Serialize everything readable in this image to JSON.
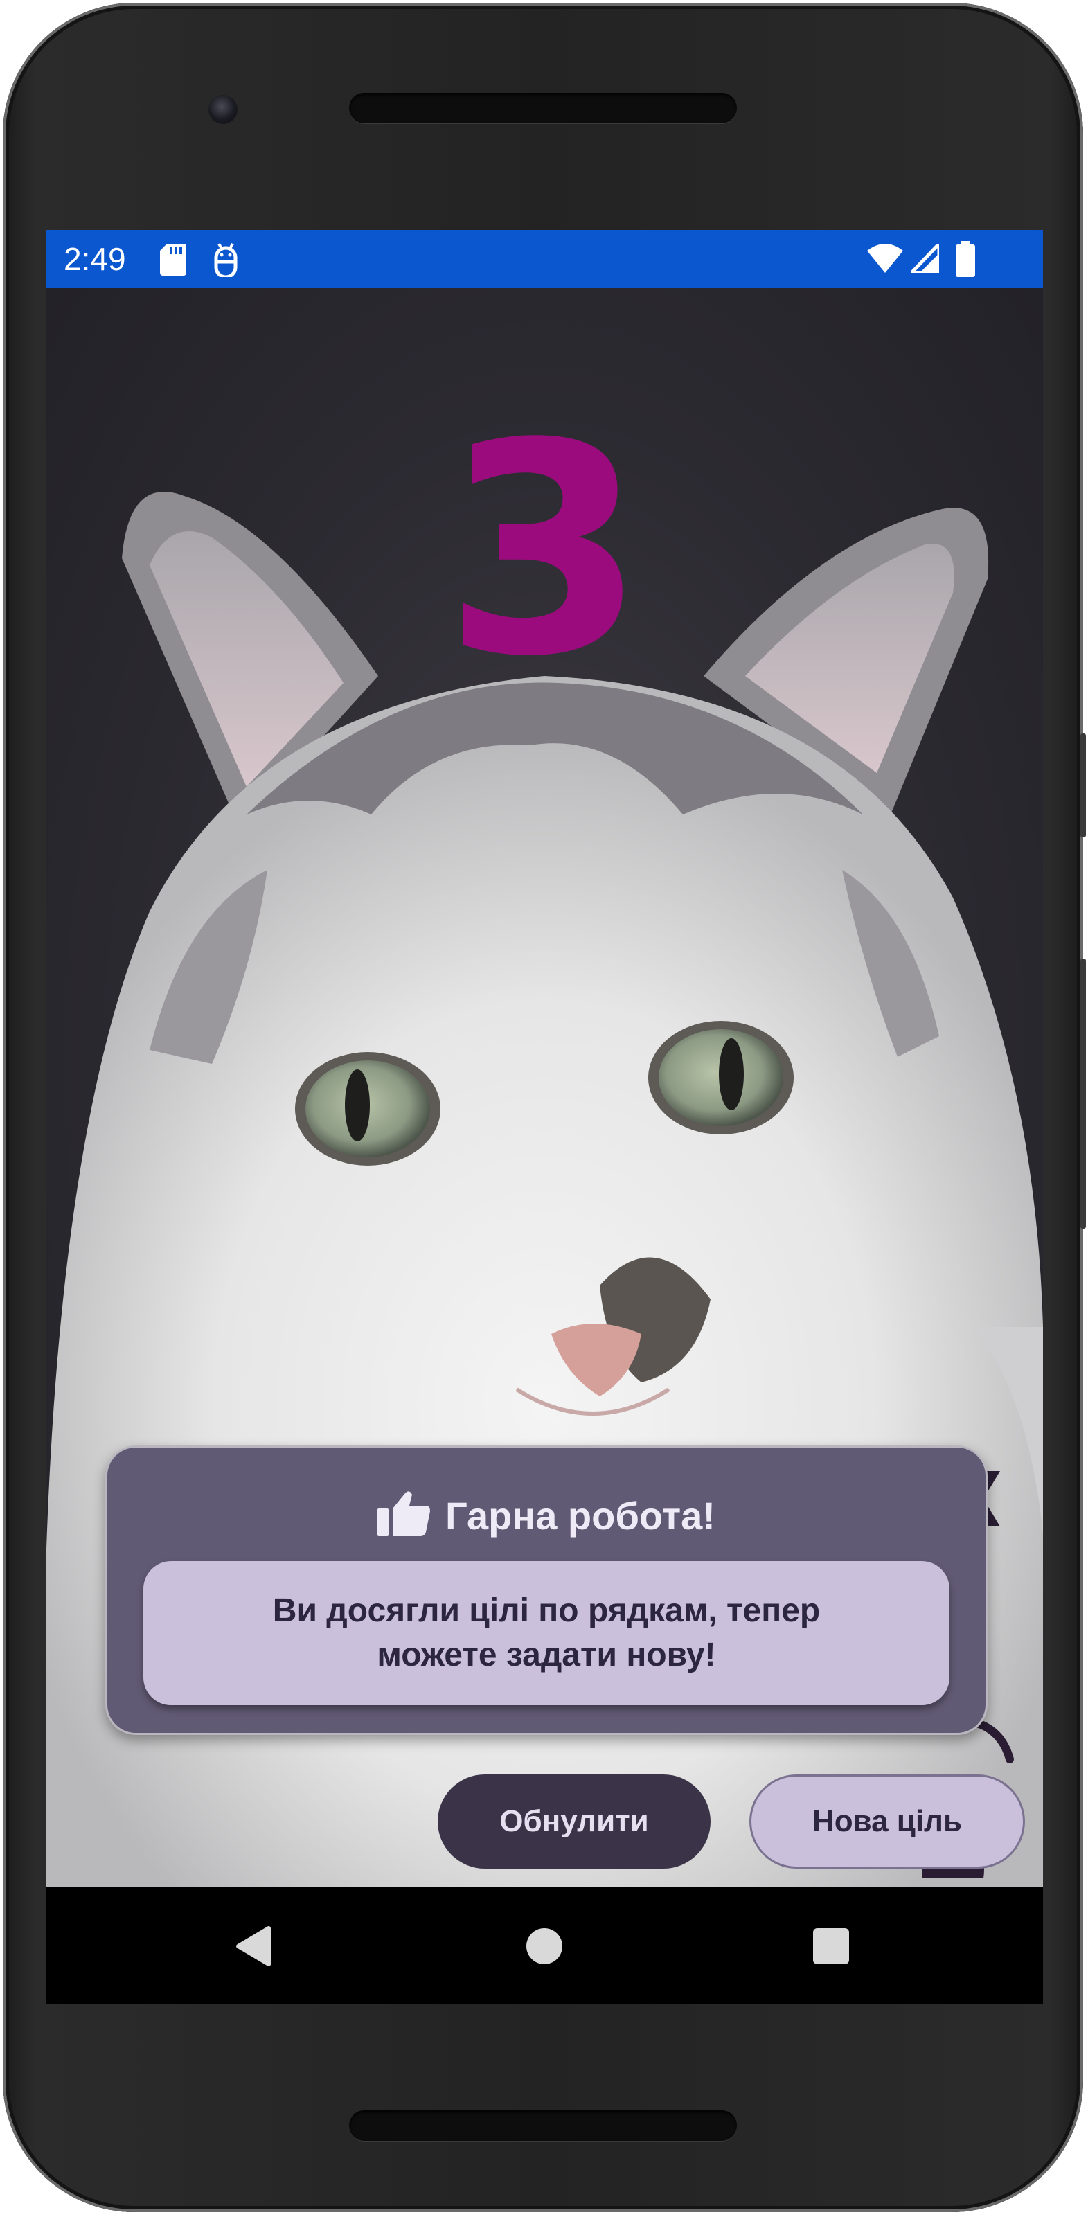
{
  "status_bar": {
    "time": "2:49",
    "background": "#0b57d0",
    "icons": [
      "sd-card-icon",
      "android-debug-icon",
      "wifi-icon",
      "signal-icon",
      "battery-icon"
    ]
  },
  "main": {
    "counter": "3",
    "counter_color": "#9c0b7d",
    "background_image": "cat-photo",
    "side_icons": [
      "flag-icon",
      "gauge-icon",
      "bear-icon"
    ]
  },
  "dialog": {
    "title_icon": "thumbs-up-icon",
    "title": "Гарна робота!",
    "message_line1": "Ви досягли цілі по рядкам, тепер",
    "message_line2": "можете задати нову!"
  },
  "buttons": {
    "reset_label": "Обнулити",
    "new_goal_label": "Нова ціль"
  },
  "nav_bar": {
    "icons": [
      "back-icon",
      "home-icon",
      "recents-icon"
    ]
  }
}
